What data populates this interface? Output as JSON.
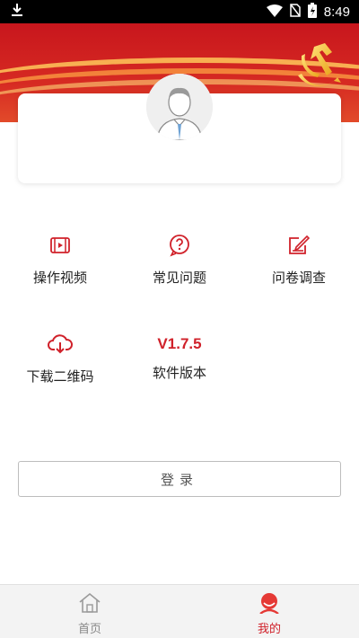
{
  "status_bar": {
    "time": "8:49"
  },
  "menu": {
    "items": [
      {
        "label": "操作视频",
        "icon": "video-icon"
      },
      {
        "label": "常见问题",
        "icon": "question-icon"
      },
      {
        "label": "问卷调查",
        "icon": "survey-icon"
      },
      {
        "label": "下载二维码",
        "icon": "cloud-download-icon"
      },
      {
        "label": "软件版本",
        "value": "V1.7.5"
      }
    ]
  },
  "login": {
    "label": "登录"
  },
  "bottom_nav": {
    "items": [
      {
        "label": "首页",
        "icon": "home-icon",
        "active": false
      },
      {
        "label": "我的",
        "icon": "user-icon",
        "active": true
      }
    ]
  },
  "colors": {
    "accent": "#d0212a",
    "banner": "#c8161d",
    "inactive": "#888888"
  }
}
